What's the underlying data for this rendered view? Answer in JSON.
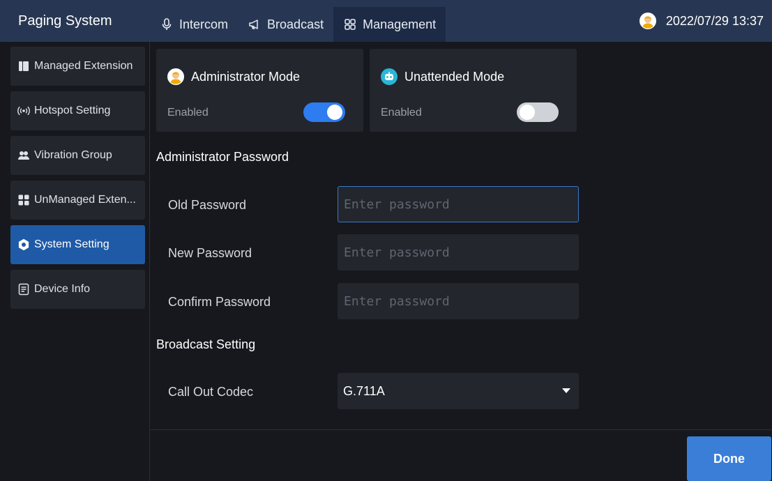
{
  "app": {
    "title": "Paging System"
  },
  "top_tabs": [
    {
      "label": "Intercom",
      "icon": "microphone-icon",
      "active": false
    },
    {
      "label": "Broadcast",
      "icon": "megaphone-icon",
      "active": false
    },
    {
      "label": "Management",
      "icon": "grid-icon",
      "active": true
    }
  ],
  "header": {
    "datetime": "2022/07/29 13:37",
    "avatar_icon": "administrator-avatar-icon"
  },
  "sidebar": {
    "items": [
      {
        "label": "Managed Extension",
        "icon": "book-icon",
        "active": false
      },
      {
        "label": "Hotspot Setting",
        "icon": "hotspot-icon",
        "active": false
      },
      {
        "label": "Vibration Group",
        "icon": "group-icon",
        "active": false
      },
      {
        "label": "UnManaged Exten...",
        "icon": "tiles-icon",
        "active": false
      },
      {
        "label": "System Setting",
        "icon": "gear-icon",
        "active": true
      },
      {
        "label": "Device Info",
        "icon": "document-icon",
        "active": false
      }
    ]
  },
  "modes": {
    "administrator": {
      "title": "Administrator Mode",
      "state_label": "Enabled",
      "enabled": true
    },
    "unattended": {
      "title": "Unattended Mode",
      "state_label": "Enabled",
      "enabled": false
    }
  },
  "password_section": {
    "title": "Administrator Password",
    "old": {
      "label": "Old Password",
      "placeholder": "Enter password",
      "value": ""
    },
    "new": {
      "label": "New Password",
      "placeholder": "Enter password",
      "value": ""
    },
    "confirm": {
      "label": "Confirm Password",
      "placeholder": "Enter password",
      "value": ""
    }
  },
  "broadcast_section": {
    "title": "Broadcast Setting",
    "codec_label": "Call Out Codec",
    "codec_value": "G.711A"
  },
  "actions": {
    "done_label": "Done"
  },
  "colors": {
    "topbar": "#273753",
    "accent": "#3a7ed8",
    "active_sidebar": "#1f5aa6",
    "card": "#23262d",
    "background": "#16181d"
  }
}
